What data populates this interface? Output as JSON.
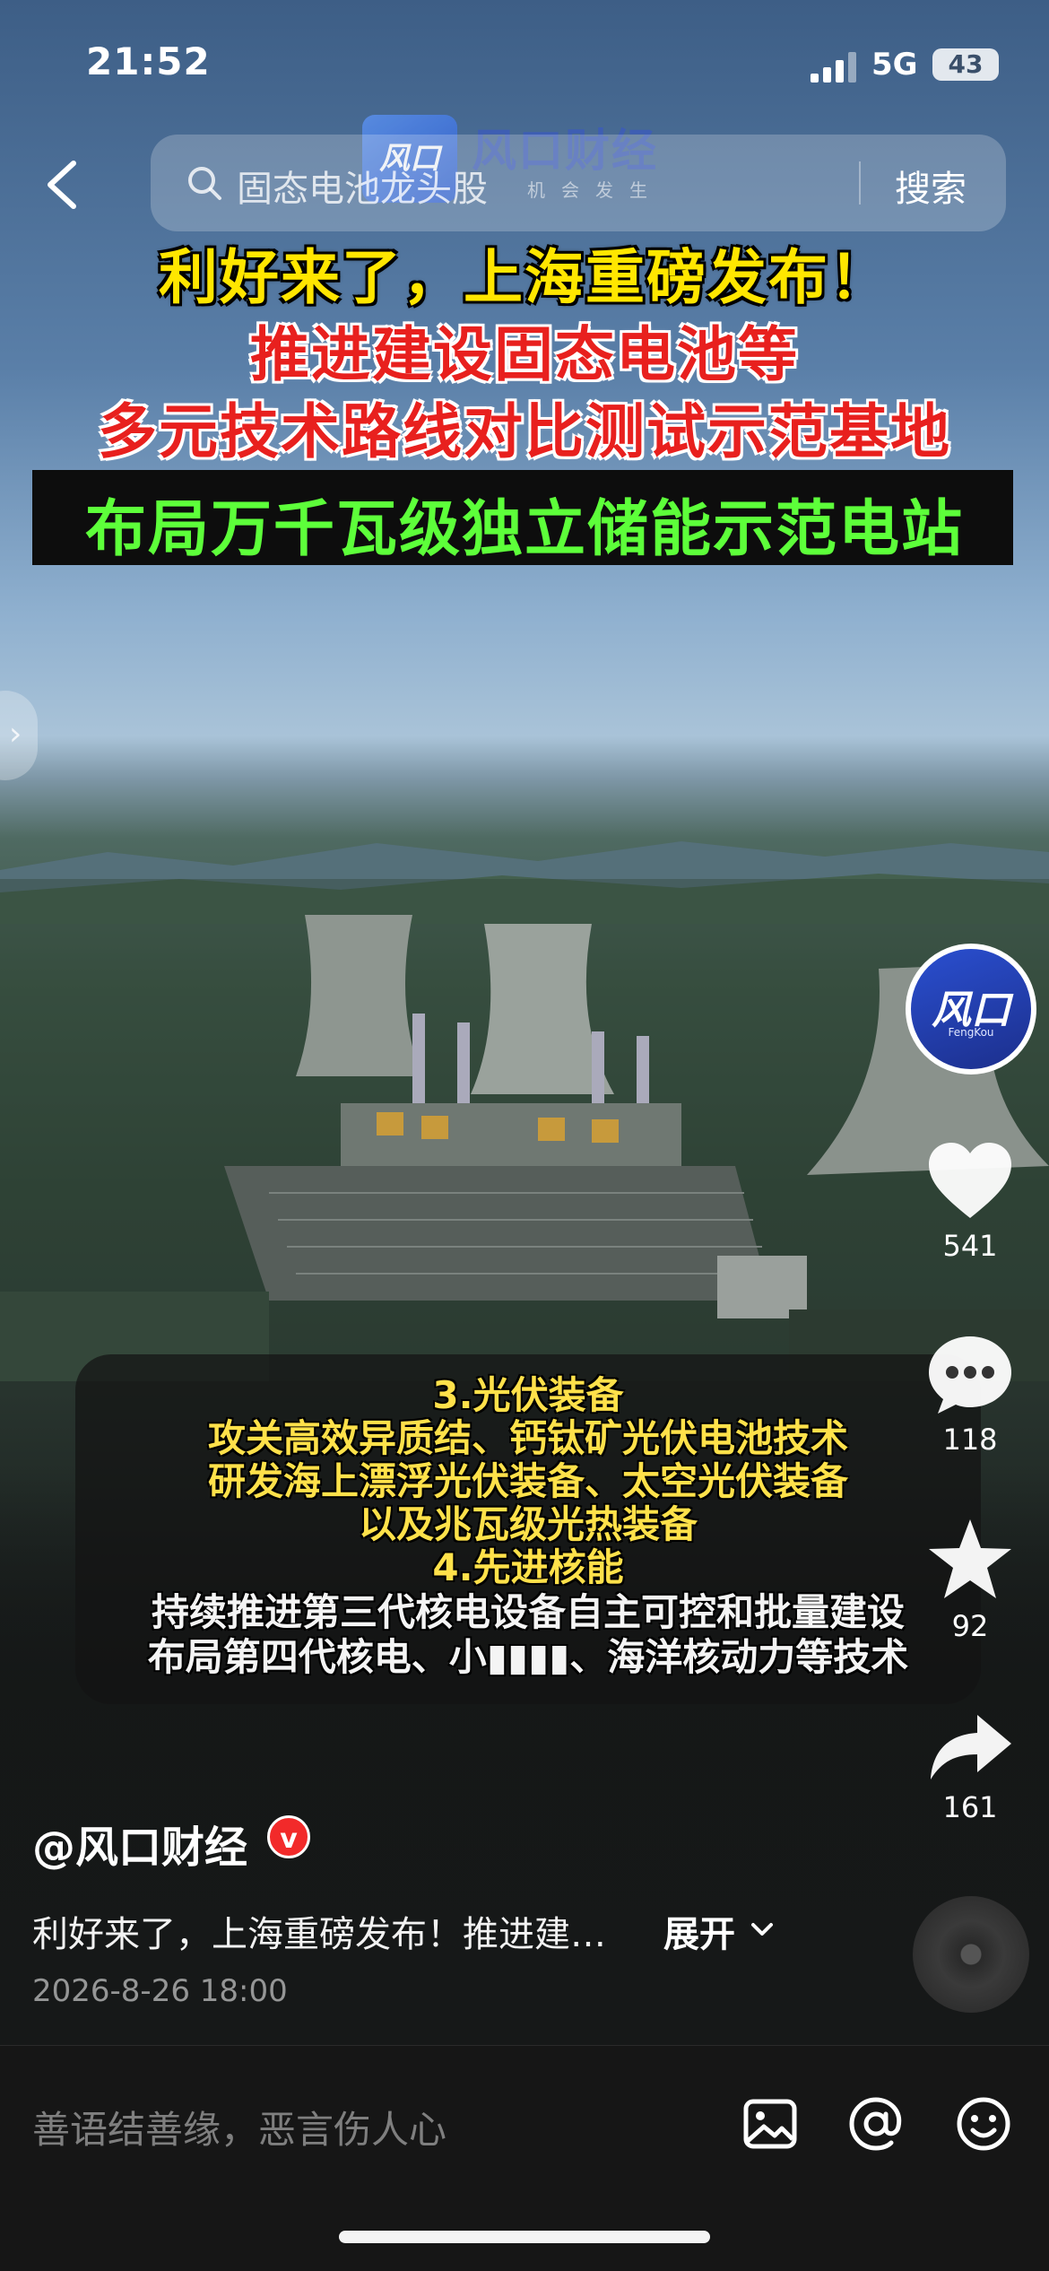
{
  "status_bar": {
    "time": "21:52",
    "network": "5G",
    "battery": "43"
  },
  "search": {
    "query": "固态电池龙头股",
    "button": "搜索"
  },
  "watermark": {
    "logo_text": "风口",
    "name": "风口财经",
    "slogan": "机会发生"
  },
  "headline": {
    "line1": "利好来了，上海重磅发布！",
    "line2": "推进建设固态电池等",
    "line3": "多元技术路线对比测试示范基地",
    "line4": "布局万千瓦级独立储能示范电站"
  },
  "subtitles": [
    {
      "text": "3.光伏装备",
      "color": "yellow"
    },
    {
      "text": "攻关高效异质结、钙钛矿光伏电池技术",
      "color": "yellow"
    },
    {
      "text": "研发海上漂浮光伏装备、太空光伏装备",
      "color": "yellow"
    },
    {
      "text": "以及兆瓦级光热装备",
      "color": "yellow"
    },
    {
      "text": "4.先进核能",
      "color": "yellow"
    },
    {
      "text": "持续推进第三代核电设备自主可控和批量建设",
      "color": "white"
    },
    {
      "text": "布局第四代核电、小▮▮▮▮、海洋核动力等技术",
      "color": "white"
    }
  ],
  "rail": {
    "avatar_text": "风口",
    "avatar_sub": "FengKou",
    "likes": "541",
    "comments": "118",
    "favorites": "92",
    "shares": "161"
  },
  "post": {
    "author": "@风口财经",
    "verified_badge": "v",
    "description": "利好来了，上海重磅发布！推进建…",
    "expand": "展开",
    "date": "2026-8-26 18:00"
  },
  "comment_bar": {
    "placeholder": "善语结善缘，恶言伤人心"
  },
  "colors": {
    "headline_yellow": "#ffe600",
    "headline_red": "#e8201e",
    "headline_green": "#5dff3a",
    "verified": "#f22a2a"
  }
}
